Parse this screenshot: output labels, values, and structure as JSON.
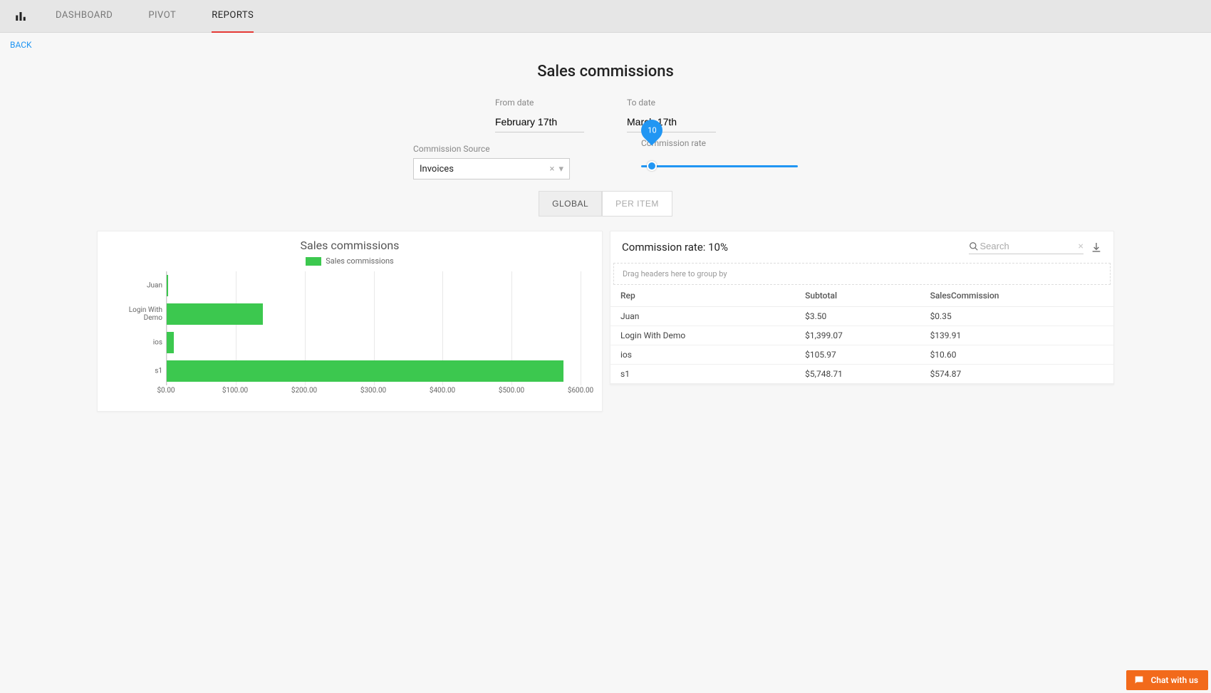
{
  "nav": {
    "tabs": [
      "DASHBOARD",
      "PIVOT",
      "REPORTS"
    ],
    "active_index": 2
  },
  "back_label": "BACK",
  "title": "Sales commissions",
  "filters": {
    "from_label": "From date",
    "from_value": "February 17th",
    "to_label": "To date",
    "to_value": "March 17th",
    "source_label": "Commission Source",
    "source_value": "Invoices",
    "rate_label": "Commission rate",
    "rate_value": "10"
  },
  "toggle": {
    "options": [
      "GLOBAL",
      "PER ITEM"
    ],
    "active_index": 0
  },
  "chart": {
    "title": "Sales commissions",
    "legend": "Sales commissions"
  },
  "table": {
    "title": "Commission rate: 10%",
    "search_placeholder": "Search",
    "group_hint": "Drag headers here to group by",
    "columns": [
      "Rep",
      "Subtotal",
      "SalesCommission"
    ],
    "rows": [
      {
        "rep": "Juan",
        "subtotal": "$3.50",
        "commission": "$0.35"
      },
      {
        "rep": "Login With Demo",
        "subtotal": "$1,399.07",
        "commission": "$139.91"
      },
      {
        "rep": "ios",
        "subtotal": "$105.97",
        "commission": "$10.60"
      },
      {
        "rep": "s1",
        "subtotal": "$5,748.71",
        "commission": "$574.87"
      }
    ]
  },
  "chat_label": "Chat with us",
  "colors": {
    "accent_red": "#e53935",
    "accent_blue": "#2196f3",
    "bar_green": "#3cc84f",
    "chat_orange": "#f26a1b"
  },
  "chart_data": {
    "type": "bar",
    "orientation": "horizontal",
    "title": "Sales commissions",
    "xlabel": "",
    "ylabel": "",
    "xlim": [
      0,
      600
    ],
    "x_ticks": [
      "$0.00",
      "$100.00",
      "$200.00",
      "$300.00",
      "$400.00",
      "$500.00",
      "$600.00"
    ],
    "categories": [
      "Juan",
      "Login With Demo",
      "ios",
      "s1"
    ],
    "series": [
      {
        "name": "Sales commissions",
        "values": [
          0.35,
          139.91,
          10.6,
          574.87
        ]
      }
    ]
  }
}
